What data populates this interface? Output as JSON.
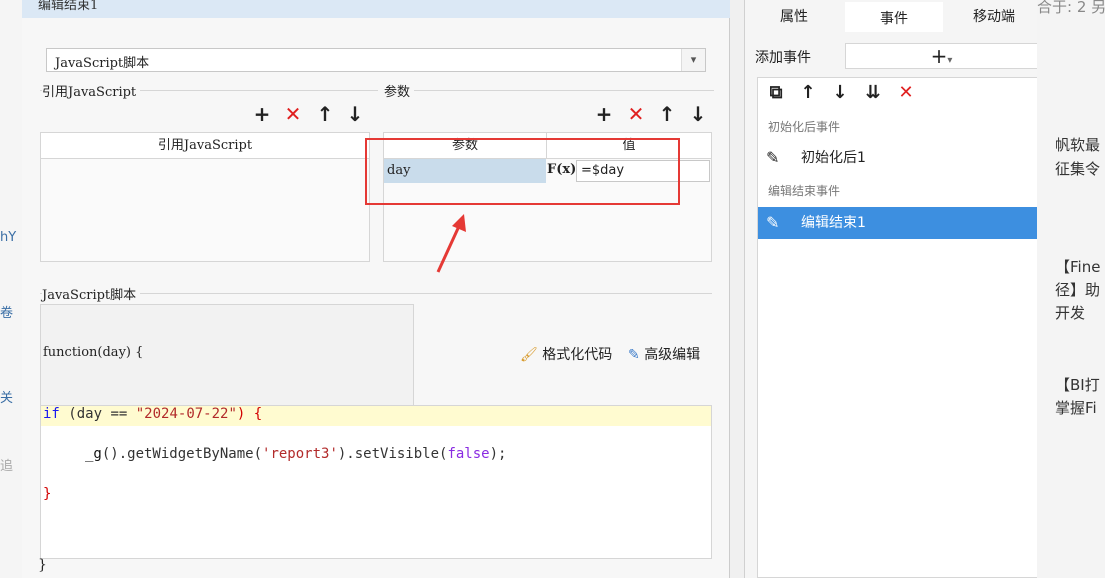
{
  "left_fragments": [
    "hY",
    "卷",
    "关",
    "追"
  ],
  "dialog": {
    "title": "编辑结束1",
    "script_type": "JavaScript脚本",
    "ref_js_section": "引用JavaScript",
    "params_section": "参数",
    "ref_js_column": "引用JavaScript",
    "param_columns": {
      "param": "参数",
      "value": "值"
    },
    "param_rows": [
      {
        "name": "day",
        "fx": "F(x)",
        "value": "=$day"
      }
    ],
    "js_section": "JavaScript脚本",
    "function_signature": "function(day) {",
    "format_code_label": "格式化代码",
    "advanced_edit_label": "高级编辑",
    "code": {
      "line1_if": "if",
      "line1_cond_var": "(day ==",
      "line1_str": "\"2024-07-22\"",
      "line1_close": ") {",
      "line2_prefix": "_g",
      "line2_mid": "().getWidgetByName(",
      "line2_str": "'report3'",
      "line2_mid2": ").setVisible(",
      "line2_bool": "false",
      "line2_end": ");",
      "line3": "}"
    },
    "closing_brace": "}"
  },
  "right_panel": {
    "tabs": [
      "属性",
      "事件",
      "移动端"
    ],
    "active_tab": "事件",
    "add_event_label": "添加事件",
    "add_event_symbol": "+",
    "categories": [
      {
        "label": "初始化后事件",
        "items": [
          "初始化后1"
        ]
      },
      {
        "label": "编辑结束事件",
        "items": [
          "编辑结束1"
        ]
      }
    ],
    "selected_item": "编辑结束1"
  },
  "far_right_fragments": {
    "top": "合于: 2 另",
    "lines": [
      "帆软最",
      "征集令",
      "【Fine",
      "径】助",
      "开发",
      "【BI打",
      "掌握Fi"
    ]
  },
  "colors": {
    "accent": "#3d8fe0",
    "highlight_row": "#c9dceb",
    "annotation_red": "#e53935",
    "code_line_highlight": "#fffbd0"
  }
}
